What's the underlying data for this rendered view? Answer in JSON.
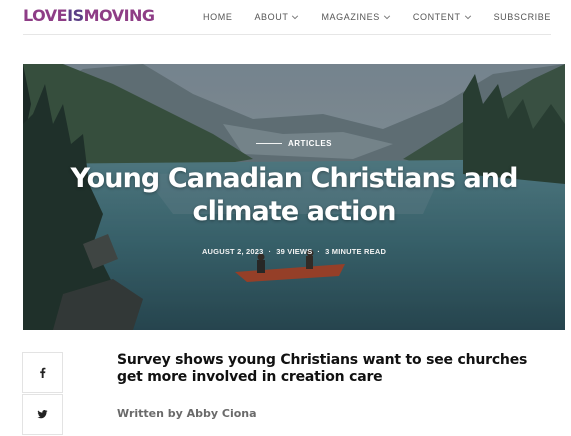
{
  "logo": {
    "part1": "LOVE",
    "part2": "IS",
    "part3": "MOVING"
  },
  "nav": [
    {
      "label": "HOME",
      "has_dropdown": false
    },
    {
      "label": "ABOUT",
      "has_dropdown": true
    },
    {
      "label": "MAGAZINES",
      "has_dropdown": true
    },
    {
      "label": "CONTENT",
      "has_dropdown": true
    },
    {
      "label": "SUBSCRIBE",
      "has_dropdown": false
    }
  ],
  "hero": {
    "category": "ARTICLES",
    "title": "Young Canadian Christians and climate action",
    "date": "AUGUST 2, 2023",
    "views": "39 VIEWS",
    "read_time": "3 MINUTE READ",
    "meta_separator": "·"
  },
  "share": {
    "facebook_icon": "facebook-icon",
    "twitter_icon": "twitter-icon"
  },
  "article": {
    "subtitle": "Survey shows young Christians want to see churches get more involved in creation care",
    "author": "Written by Abby Ciona"
  },
  "colors": {
    "logo_love": "#8e3d86",
    "logo_is": "#5b3e86",
    "text_dark": "#111111",
    "nav_text": "#555555"
  }
}
